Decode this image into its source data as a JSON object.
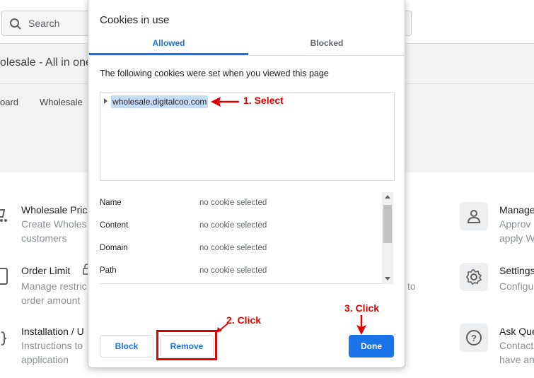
{
  "background": {
    "search_placeholder": "Search",
    "page_title": "olesale - All in one",
    "nav_items": [
      "oard",
      "Wholesale"
    ],
    "cards_left": [
      {
        "title": "Wholesale Pric",
        "desc": [
          "Create Wholes",
          "customers"
        ]
      },
      {
        "title": "Order Limit",
        "desc": [
          "Manage restric",
          "order amount"
        ]
      },
      {
        "title": "Installation / U",
        "desc": [
          "Instructions to",
          "application"
        ]
      }
    ],
    "middle_fragment": "to",
    "cards_right": [
      {
        "title": "Manage",
        "desc": [
          "Approv",
          "apply W"
        ]
      },
      {
        "title": "Settings",
        "desc": [
          "Configu"
        ]
      },
      {
        "title": "Ask Que",
        "desc": [
          "Contact",
          "have an"
        ]
      }
    ]
  },
  "dialog": {
    "title": "Cookies in use",
    "tabs": [
      {
        "label": "Allowed",
        "active": true
      },
      {
        "label": "Blocked",
        "active": false
      }
    ],
    "intro": "The following cookies were set when you viewed this page",
    "tree": {
      "selected_item": "wholesale.digitalcoo.com"
    },
    "details": [
      {
        "label": "Name",
        "value": "no cookie selected"
      },
      {
        "label": "Content",
        "value": "no cookie selected"
      },
      {
        "label": "Domain",
        "value": "no cookie selected"
      },
      {
        "label": "Path",
        "value": "no cookie selected"
      }
    ],
    "buttons": {
      "block": "Block",
      "remove": "Remove",
      "done": "Done"
    }
  },
  "annotations": {
    "step1": "1. Select",
    "step2": "2. Click",
    "step3": "3. Click",
    "color": "#e00000"
  },
  "colors": {
    "accent": "#1a73e8",
    "selection": "#c5dcf7"
  }
}
